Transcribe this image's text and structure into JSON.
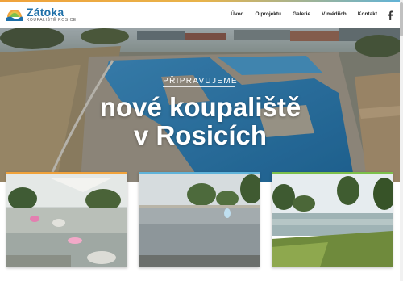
{
  "brand": {
    "title": "Zátoka",
    "subtitle": "KOUPALIŠTĚ ROSICE"
  },
  "nav": [
    {
      "label": "Úvod"
    },
    {
      "label": "O projektu"
    },
    {
      "label": "Galerie"
    },
    {
      "label": "V médiích"
    },
    {
      "label": "Kontakt"
    }
  ],
  "social": {
    "icon": "facebook-icon"
  },
  "hero": {
    "kicker": "PŘIPRAVUJEME",
    "title_line1": "nové koupaliště",
    "title_line2": "v Rosicích"
  },
  "colors": {
    "brand_blue": "#1d6fa8",
    "card1_bar": "#f0a23b",
    "card2_bar": "#5fb3d9",
    "card3_bar": "#7cc04b"
  }
}
